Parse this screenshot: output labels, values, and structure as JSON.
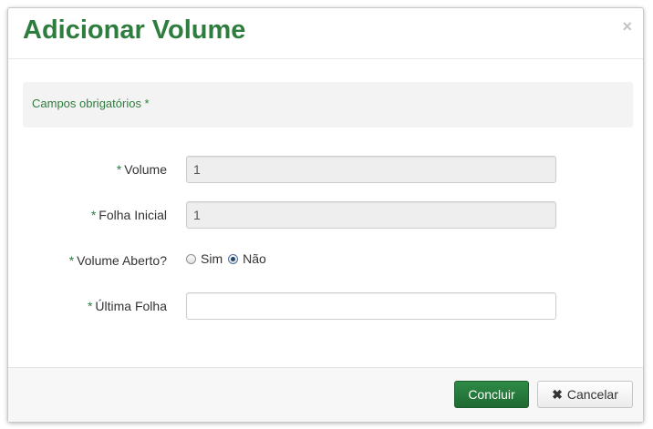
{
  "modal": {
    "title": "Adicionar Volume",
    "close_icon": "×"
  },
  "info": {
    "text": "Campos obrigatórios *"
  },
  "form": {
    "required_mark": "*",
    "volume": {
      "label": "Volume",
      "value": "1"
    },
    "folha_inicial": {
      "label": "Folha Inicial",
      "value": "1"
    },
    "volume_aberto": {
      "label": "Volume Aberto?",
      "options": [
        {
          "label": "Sim",
          "checked": false
        },
        {
          "label": "Não",
          "checked": true
        }
      ]
    },
    "ultima_folha": {
      "label": "Última Folha",
      "value": ""
    }
  },
  "footer": {
    "concluir_label": "Concluir",
    "cancelar_label": "Cancelar",
    "cancelar_icon": "✖"
  },
  "colors": {
    "brand_green": "#2f7d3e",
    "primary_button": "#1f6a33",
    "readonly_bg": "#eeeeee"
  }
}
